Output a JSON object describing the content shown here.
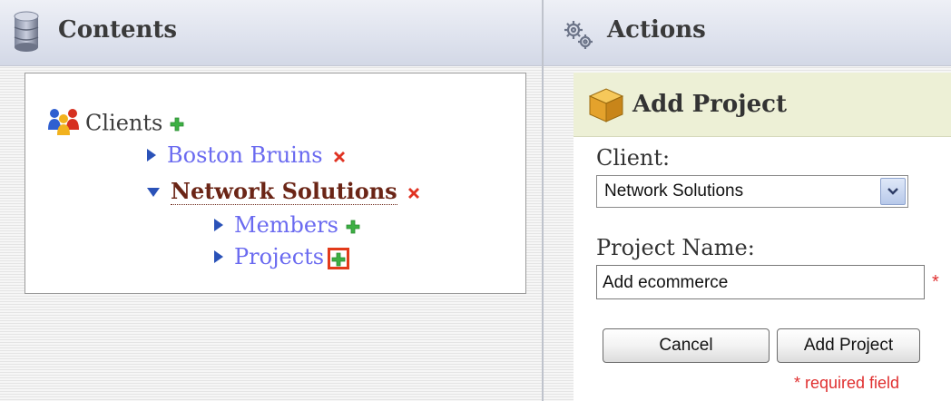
{
  "contents": {
    "title": "Contents",
    "tree": {
      "root": {
        "label": "Clients"
      },
      "children": [
        {
          "label": "Boston Bruins",
          "expanded": false
        },
        {
          "label": "Network Solutions",
          "expanded": true,
          "current": true,
          "children": [
            {
              "label": "Members"
            },
            {
              "label": "Projects"
            }
          ]
        }
      ]
    }
  },
  "actions": {
    "title": "Actions",
    "form": {
      "title": "Add Project",
      "client_label": "Client:",
      "client_selected": "Network Solutions",
      "project_name_label": "Project Name:",
      "project_name_value": "Add ecommerce",
      "required_marker": "*",
      "cancel_label": "Cancel",
      "submit_label": "Add Project",
      "required_note": "* required field"
    }
  },
  "colors": {
    "link": "#6a6af0",
    "current": "#6b2516",
    "required": "#e03030",
    "add_icon": "#3cb043",
    "remove_icon": "#e03322"
  },
  "icons": [
    "database-icon",
    "gears-icon",
    "users-icon",
    "plus-icon",
    "remove-icon",
    "package-icon",
    "chevron-down-icon"
  ]
}
